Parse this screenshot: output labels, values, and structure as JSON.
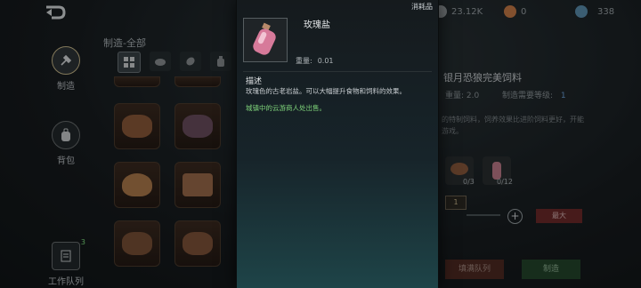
{
  "resources": [
    {
      "icon": "hunger-icon",
      "value": "23.12K",
      "color": "#b0b5b8"
    },
    {
      "icon": "coin-icon",
      "value": "0",
      "color": "#c87b47"
    },
    {
      "icon": "gem-icon",
      "value": "338",
      "color": "#5b8fb0"
    }
  ],
  "nav": {
    "craft_label": "制造",
    "backpack_label": "背包",
    "queue_label": "工作队列",
    "queue_badge": "3"
  },
  "panel": {
    "title": "制造-全部"
  },
  "detail": {
    "name": "银月恐狼完美饲料",
    "weight_label": "重量: 2.0",
    "level_label": "制造需要等级:",
    "level_value": "1",
    "desc_line1": "的特制饲料，饲养效果比进阶饲料更好，开能",
    "desc_line2": "游戏。",
    "mat1_count": "0/3",
    "mat2_count": "0/12",
    "qty": "1",
    "max_label": "最大",
    "queue_btn": "填满队列",
    "craft_btn": "制造"
  },
  "tooltip": {
    "tag": "消耗品",
    "name": "玫瑰盐",
    "weight_label": "重量:",
    "weight_value": "0.01",
    "desc_heading": "描述",
    "desc_text": "玫瑰色的古老岩盐。可以大幅提升食物和饲料的效果。",
    "source_text": "城镇中的云游商人处出售。"
  }
}
